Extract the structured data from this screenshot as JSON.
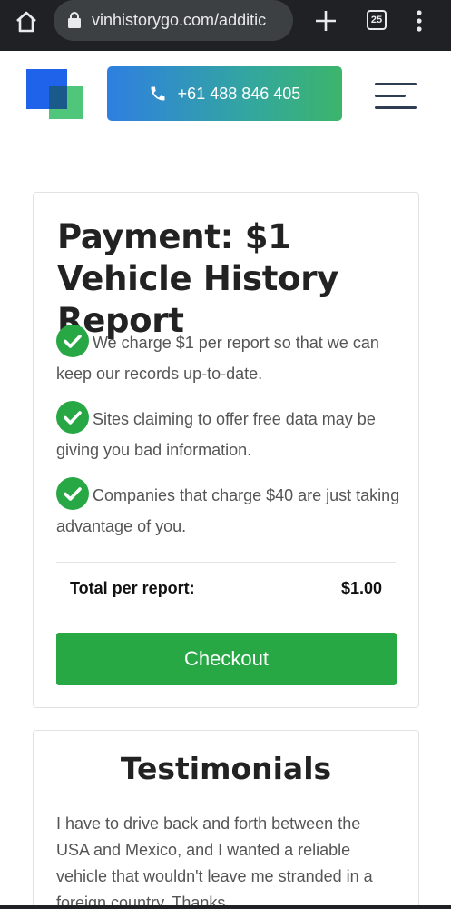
{
  "browser": {
    "url": "vinhistorygo.com/additic",
    "tab_count": "25"
  },
  "header": {
    "phone": "+61 488 846 405"
  },
  "payment": {
    "title": "Payment: $1 Vehicle History Report",
    "features": [
      "We charge $1 per report so that we can keep our records up-to-date.",
      "Sites claiming to offer free data may be giving you bad information.",
      "Companies that charge $40 are just taking advantage of you."
    ],
    "total_label": "Total per report:",
    "total_value": "$1.00",
    "checkout_label": "Checkout"
  },
  "testimonials": {
    "title": "Testimonials",
    "text": "I have to drive back and forth between the USA and Mexico, and I wanted a reliable vehicle that wouldn't leave me stranded in a foreign country. Thanks"
  },
  "colors": {
    "accent_green": "#28a745",
    "phone_gradient_start": "#2f7fe0",
    "phone_gradient_end": "#3cb56b",
    "check_green": "#28a745"
  }
}
